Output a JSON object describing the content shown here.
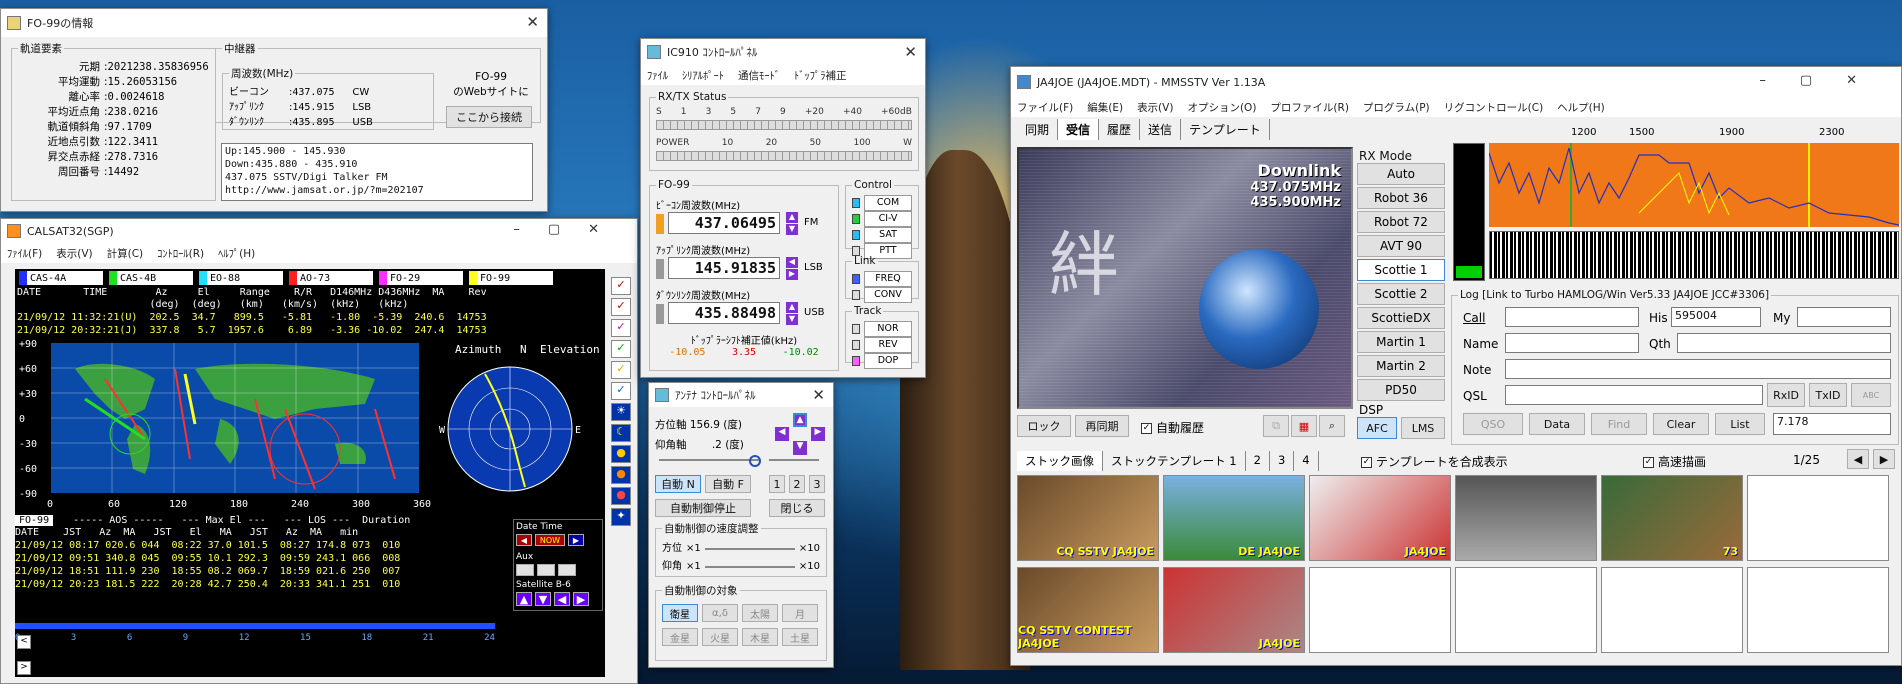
{
  "fo99win": {
    "title": "FO-99の情報",
    "orbit_legend": "軌道要素",
    "orbit": [
      {
        "k": "元期",
        "v": "2021238.35836956"
      },
      {
        "k": "平均運動",
        "v": "15.26053156"
      },
      {
        "k": "離心率",
        "v": "0.0024618"
      },
      {
        "k": "平均近点角",
        "v": "238.0216"
      },
      {
        "k": "軌道傾斜角",
        "v": "97.1709"
      },
      {
        "k": "近地点引数",
        "v": "122.3411"
      },
      {
        "k": "昇交点赤経",
        "v": "278.7316"
      },
      {
        "k": "周回番号",
        "v": "14492"
      }
    ],
    "relay_legend": "中継器",
    "freq_legend": "周波数(MHz)",
    "freqs": [
      {
        "k": "ビーコン",
        "v": "437.075",
        "m": "CW"
      },
      {
        "k": "ｱｯﾌﾟﾘﾝｸ",
        "v": "145.915",
        "m": "LSB"
      },
      {
        "k": "ﾀﾞｳﾝﾘﾝｸ",
        "v": "435.895",
        "m": "USB"
      }
    ],
    "web_text1": "FO-99",
    "web_text2": "のWebサイトに",
    "web_btn": "ここから接続",
    "notes": [
      "Up:145.900 - 145.930",
      "Down:435.880 - 435.910",
      "437.075 SSTV/Digi Talker FM",
      "http://www.jamsat.or.jp/?m=202107"
    ]
  },
  "calsat": {
    "title": "CALSAT32(SGP)",
    "menu": [
      "ﾌｧｲﾙ(F)",
      "表示(V)",
      "計算(C)",
      "ｺﾝﾄﾛｰﾙ(R)",
      "ﾍﾙﾌﾟ(H)"
    ],
    "sats": [
      {
        "n": "CAS-4A",
        "c": "#2030ff"
      },
      {
        "n": "CAS-4B",
        "c": "#20e020"
      },
      {
        "n": "EO-88",
        "c": "#20e0ff"
      },
      {
        "n": "AO-73",
        "c": "#ff2020"
      },
      {
        "n": "FO-29",
        "c": "#ff30ff"
      },
      {
        "n": "FO-99",
        "c": "#ffff20"
      }
    ],
    "hdr1": "DATE       TIME        Az     El     Range    R/R   D146MHz D436MHz  MA    Rev",
    "hdr2": "                      (deg)  (deg)   (km)   (km/s)  (kHz)   (kHz)",
    "row1": "21/09/12 11:32:21(U)  202.5  34.7   899.5   -5.81   -1.80  -5.39  240.6  14753",
    "row2": "21/09/12 20:32:21(J)  337.8   5.7  1957.6    6.89   -3.36 -10.02  247.4  14753",
    "lat_ticks": [
      "+90",
      "+60",
      "+30",
      "0",
      "-30",
      "-60",
      "-90"
    ],
    "lon_ticks": [
      "0",
      "60",
      "120",
      "180",
      "240",
      "300",
      "360"
    ],
    "az_label": "Azimuth",
    "el_label": "Elevation",
    "compass": {
      "n": "N",
      "s": "S",
      "w": "W",
      "e": "E"
    },
    "sel": "FO-99",
    "pass_hdr1": "  ----- AOS -----   --- Max El ---   --- LOS ---  Duration",
    "pass_hdr2": "DATE    JST   Az  MA   JST   El   MA   JST   Az  MA   min",
    "passes": [
      "21/09/12 08:17 020.6 044  08:22 37.0 101.5  08:27 174.8 073  010",
      "21/09/12 09:51 340.8 045  09:55 10.1 292.3  09:59 243.1 066  008",
      "21/09/12 18:51 111.9 230  18:55 08.2 069.7  18:59 021.6 250  007",
      "21/09/12 20:23 181.5 222  20:28 42.7 250.4  20:33 341.1 251  010"
    ],
    "datetime_label": "Date Time",
    "now_btn": "NOW",
    "aux_label": "Aux",
    "satellite_label": "Satellite  B-6",
    "scale": [
      "0",
      "3",
      "6",
      "9",
      "12",
      "15",
      "18",
      "21",
      "24"
    ]
  },
  "ic910": {
    "title": "IC910 ｺﾝﾄﾛｰﾙﾊﾟﾈﾙ",
    "menu": [
      "ﾌｧｲﾙ",
      "ｼﾘｱﾙﾎﾟｰﾄ",
      "通信ﾓｰﾄﾞ",
      "ﾄﾞｯﾌﾟﾗ補正"
    ],
    "rxtx_label": "RX/TX Status",
    "s_scale": [
      "S",
      "1",
      "3",
      "5",
      "7",
      "9",
      "+20",
      "+40",
      "+60dB"
    ],
    "pwr_scale": [
      "POWER",
      "10",
      "20",
      "50",
      "100",
      "W"
    ],
    "sat_label": "FO-99",
    "beacon_label": "ﾋﾞｰｺﾝ周波数(MHz)",
    "beacon": "437.06495",
    "beacon_mode": "FM",
    "up_label": "ｱｯﾌﾟﾘﾝｸ周波数(MHz)",
    "up": "145.91835",
    "up_mode": "LSB",
    "down_label": "ﾀﾞｳﾝﾘﾝｸ周波数(MHz)",
    "down": "435.88498",
    "down_mode": "USB",
    "doppler_label": "ﾄﾞｯﾌﾟﾗｰｼﾌﾄ補正値(kHz)",
    "doppler": [
      "-10.05",
      "3.35",
      "-10.02"
    ],
    "control_label": "Control",
    "control": [
      "COM",
      "CI-V",
      "SAT",
      "PTT"
    ],
    "link_label": "Link",
    "link": [
      "FREQ",
      "CONV"
    ],
    "track_label": "Track",
    "track": [
      "NOR",
      "REV",
      "DOP"
    ]
  },
  "antenna": {
    "title": "ｱﾝﾃﾅ ｺﾝﾄﾛｰﾙﾊﾟﾈﾙ",
    "az_label": "方位軸",
    "az": "156.9 (度)",
    "el_label": "仰角軸",
    "el": ".2 (度)",
    "auto_n": "自動 N",
    "auto_f": "自動 F",
    "nums": [
      "1",
      "2",
      "3"
    ],
    "stop": "自動制御停止",
    "close": "閉じる",
    "speed_label": "自動制御の速度調整",
    "speed_az": "方位",
    "speed_el": "仰角",
    "x1": "×1",
    "x10": "×10",
    "target_label": "自動制御の対象",
    "targets": [
      "衛星",
      "α,δ",
      "太陽",
      "月",
      "金星",
      "火星",
      "木星",
      "土星"
    ]
  },
  "mmsstv": {
    "title": "JA4JOE (JA4JOE.MDT) - MMSSTV Ver 1.13A",
    "menu": [
      "ファイル(F)",
      "編集(E)",
      "表示(V)",
      "オプション(O)",
      "プロファイル(R)",
      "プログラム(P)",
      "リグコントロール(C)",
      "ヘルプ(H)"
    ],
    "tabs": [
      "同期",
      "受信",
      "履歴",
      "送信",
      "テンプレート"
    ],
    "rx_mode_label": "RX Mode",
    "modes": [
      "Auto",
      "Robot 36",
      "Robot 72",
      "AVT 90",
      "Scottie 1",
      "Scottie 2",
      "ScottieDX",
      "Martin 1",
      "Martin 2",
      "PD50"
    ],
    "freq_ticks": [
      "1200",
      "1500",
      "1900",
      "2300"
    ],
    "img_text1": "Downlink",
    "img_text2": "437.075MHz",
    "img_text3": "435.900MHz",
    "lock_btn": "ロック",
    "resync_btn": "再同期",
    "autohist_label": "自動履歴",
    "dsp_label": "DSP",
    "afc_btn": "AFC",
    "lms_btn": "LMS",
    "log_label": "Log [Link to Turbo HAMLOG/Win Ver5.33  JA4JOE JCC#3306]",
    "call_label": "Call",
    "his_label": "His",
    "his_val": "595004",
    "my_label": "My",
    "name_label": "Name",
    "qth_label": "Qth",
    "note_label": "Note",
    "qsl_label": "QSL",
    "rxid_btn": "RxID",
    "txid_btn": "TxID",
    "abc_btn": "ABC",
    "qso_btn": "QSO",
    "data_btn": "Data",
    "find_btn": "Find",
    "clear_btn": "Clear",
    "list_btn": "List",
    "freq_val": "7.178",
    "stock_tabs": [
      "ストック画像",
      "ストックテンプレート 1",
      "2",
      "3",
      "4"
    ],
    "template_chk": "テンプレートを合成表示",
    "fast_chk": "高速描画",
    "page": "1/25",
    "thumb_caps": [
      "CQ SSTV JA4JOE",
      "DE JA4JOE",
      "JA4JOE",
      "",
      "73",
      "CQ SSTV CONTEST JA4JOE",
      "JA4JOE"
    ]
  }
}
